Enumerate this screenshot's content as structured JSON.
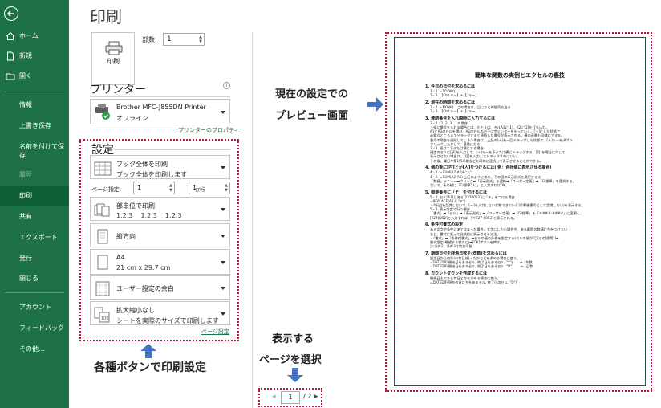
{
  "nav": {
    "home": "ホーム",
    "new": "新規",
    "open": "開く",
    "info": "情報",
    "save": "上書き保存",
    "save_as_line1": "名前を付けて保",
    "save_as_line2": "存",
    "history": "履歴",
    "print": "印刷",
    "share": "共有",
    "export": "エクスポート",
    "publish": "発行",
    "close": "閉じる",
    "account": "アカウント",
    "feedback": "フィードバック",
    "options": "その他..."
  },
  "print": {
    "title": "印刷",
    "print_button": "印刷",
    "copies_label": "部数:",
    "copies_value": "1",
    "printer_heading": "プリンター",
    "printer_name": "Brother MFC-J855DN Printer",
    "printer_status": "オフライン",
    "printer_props_link": "プリンターのプロパティ",
    "settings_heading": "設定",
    "scope_line1": "ブック全体を印刷",
    "scope_line2": "ブック全体を印刷します",
    "pages_label": "ページ指定:",
    "pages_from": "1",
    "pages_to_label": "から",
    "pages_to": "1",
    "collate_line1": "部単位で印刷",
    "collate_line2": "1,2,3    1,2,3    1,2,3",
    "orientation": "縦方向",
    "paper_size_line1": "A4",
    "paper_size_line2": "21 cm x 29.7 cm",
    "margins": "ユーザー設定の余白",
    "scaling_line1": "拡大縮小なし",
    "scaling_line2": "シートを実際のサイズで印刷します",
    "page_setup_link": "ページ設定"
  },
  "preview": {
    "current_page": "1",
    "total_pages": "/ 2"
  },
  "annotations": {
    "buttons_note": "各種ボタンで印刷設定",
    "preview_line1": "現在の設定での",
    "preview_line2": "プレビュー画面",
    "page_select_line1": "表示する",
    "page_select_line2": "ページを選択"
  },
  "document": {
    "title": "簡単な関数の実例とエクセルの裏技",
    "sections": [
      {
        "heading": "1. 今日の日付を求めるには",
        "lines": [
          "1 - 1. =TODAY()",
          "1 - 2. 【Ctrl キー】+【; キー】"
        ]
      },
      {
        "heading": "2. 現在の時間を求めるには",
        "lines": [
          "2 - 1. =NOW()　この場合は、日にちと時間両方出る",
          "2 - 2. 【Ctrl キー】+【: キー】"
        ]
      },
      {
        "heading": "3. 連続番号を入れ瞬時に入力するには",
        "lines": [
          "3 - 1. [1, 2, 3…] の場合",
          "・縦に番号を入れる場合には、たとえば、セルA1に[1]、A2に[2]を打ち込む。",
          "A1とA2のセルを選び、A2のセルの右下にポインターをもっていく。[＋]にした状態で",
          "必要なところまでドラッグすると連続した番号が表示される。横の連番も同様にできる。",
          "番号の場合を連続してしまう場合は、上記の[＋]を一回ドラッグした状態で、[＋]キーをダブル",
          "クリックしたりして、連番になる。",
          "3 - 2. 続けて下または横にする場合",
          "規定のセルに[子]を入力して、[＋]キーを下または横にドラッグする。[月]を曜日に対して",
          "表示させたい場合は、[月]を入力してドラッグすればいい。",
          "その後、曜日や第1四半期などを同様に連続して表示させることができる。"
        ]
      },
      {
        "heading": "4. 値の後に[円]とか[人]をつけるには( 例：合計値に表示させる場合)",
        "lines": [
          "4 - 1. =SUM(A2:A5)&\"人\"",
          "4 - 2. =SUM(A2:A5) 上記のように求め、その値の表示形式を変更させる",
          "「数値」メニュー➡クリック➡「表示形式」を選択➡「ユーザー定義」➡「G/標準」を選択する。",
          "次いで、その横に「G/標準\"人\"」と入力すればOK。"
        ]
      },
      {
        "heading": "5. 郵便番号に「〒」を付けるには",
        "lines": [
          "5 - 1. セル[A1]にある[2270052]に「〒」をつける場合",
          "=REPLACE(A1,0,\"〒\")",
          "・4桁目を認識しないで、[ー]を入力しない状態できて(=[ ]は郵便番号として認識しない)を表示する。",
          "5 - 2. 表示設定で行う場合",
          "「書式」➡「セル」➡「表示形式」➡「ユーザー定義」➡「G/標準」を「〒###-####」に変更し、",
          "[2270052]と入力すれば、[〒227-0052]と表示される。"
        ]
      },
      {
        "heading": "6. 条件付書式の設定",
        "lines": [
          "ある文字や条件にあてはまった場合、太字にしたい場合や、ある範囲の数値に色をつけたい",
          "など、書式に乗って自動的に表示させる方法。",
          "・「書式」➡「条件付書式」➡セルの値の条件を設定する(セルの値が[〇]との[間等])➡",
          "書式設定(希望する書式に)➡[OK]ボタンを押す。",
          "注:条件2、条件3は追加可能"
        ]
      },
      {
        "heading": "7. 期間日付を経過日数を(年数)を求めるには",
        "lines": [
          "誕生日から何年(or何日)経ったかなどを求める場合に使う。",
          "=DATEDIF(開始日をあるセル, 終了日をあるセル, \"Y\")　　→　年数",
          "=DATEDIF(開始日をあるセル, 終了日をあるセル, \"D\")　　→　日数"
        ]
      },
      {
        "heading": "8. カウントダウンを作成するには",
        "lines": [
          "開催日まであと何日とかを求める場合に使う。",
          "=DATEDIF(現在の日にちをあるセル, 終了日のセル, \"D\")"
        ]
      }
    ]
  }
}
